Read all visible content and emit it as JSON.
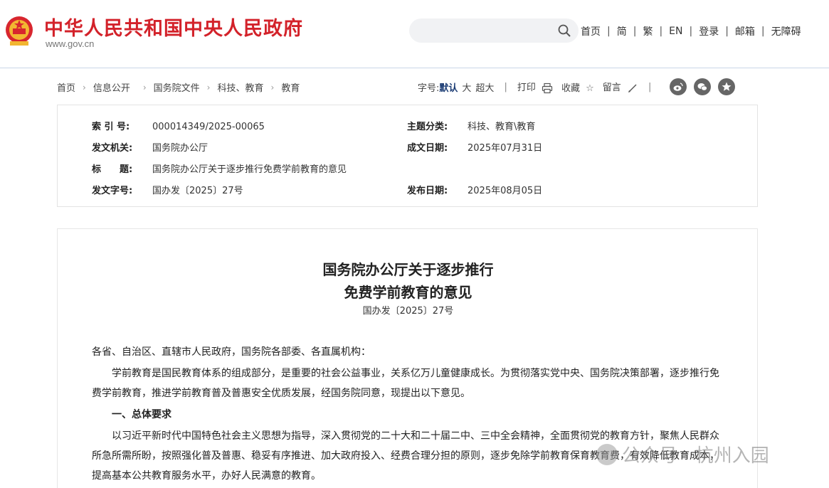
{
  "header": {
    "site_title": "中华人民共和国中央人民政府",
    "site_url": "www.gov.cn",
    "search_placeholder": "",
    "nav": [
      "首页",
      "简",
      "繁",
      "EN",
      "登录",
      "邮箱",
      "无障碍"
    ]
  },
  "breadcrumb": [
    "首页",
    "信息公开",
    "国务院文件",
    "科技、教育",
    "教育"
  ],
  "tools": {
    "font_label": "字号:",
    "font_default": "默认",
    "font_large": "大",
    "font_xlarge": "超大",
    "print": "打印",
    "favorite": "收藏",
    "comment": "留言"
  },
  "meta": {
    "index_label": "索 引 号:",
    "index_value": "000014349/2025-00065",
    "topic_label": "主题分类:",
    "topic_value": "科技、教育\\教育",
    "issuer_label": "发文机关:",
    "issuer_value": "国务院办公厅",
    "date_written_label": "成文日期:",
    "date_written_value": "2025年07月31日",
    "title_label": "标　　题:",
    "title_value": "国务院办公厅关于逐步推行免费学前教育的意见",
    "doc_no_label": "发文字号:",
    "doc_no_value": "国办发〔2025〕27号",
    "publish_label": "发布日期:",
    "publish_value": "2025年08月05日"
  },
  "article": {
    "title_line1": "国务院办公厅关于逐步推行",
    "title_line2": "免费学前教育的意见",
    "doc_no": "国办发〔2025〕27号",
    "salutation": "各省、自治区、直辖市人民政府，国务院各部委、各直属机构：",
    "para1": "学前教育是国民教育体系的组成部分，是重要的社会公益事业，关系亿万儿童健康成长。为贯彻落实党中央、国务院决策部署，逐步推行免费学前教育，推进学前教育普及普惠安全优质发展，经国务院同意，现提出以下意见。",
    "heading1": "一、总体要求",
    "para2": "以习近平新时代中国特色社会主义思想为指导，深入贯彻党的二十大和二十届二中、三中全会精神，全面贯彻党的教育方针，聚焦人民群众所急所需所盼，按照强化普及普惠、稳妥有序推进、加大政府投入、经费合理分担的原则，逐步免除学前教育保育教育费，有效降低教育成本，提高基本公共教育服务水平，办好人民满意的教育。"
  },
  "watermark": "公众号 · 杭州入园",
  "colors": {
    "brand_red": "#d3222a",
    "accent_blue": "#1a3b73"
  }
}
